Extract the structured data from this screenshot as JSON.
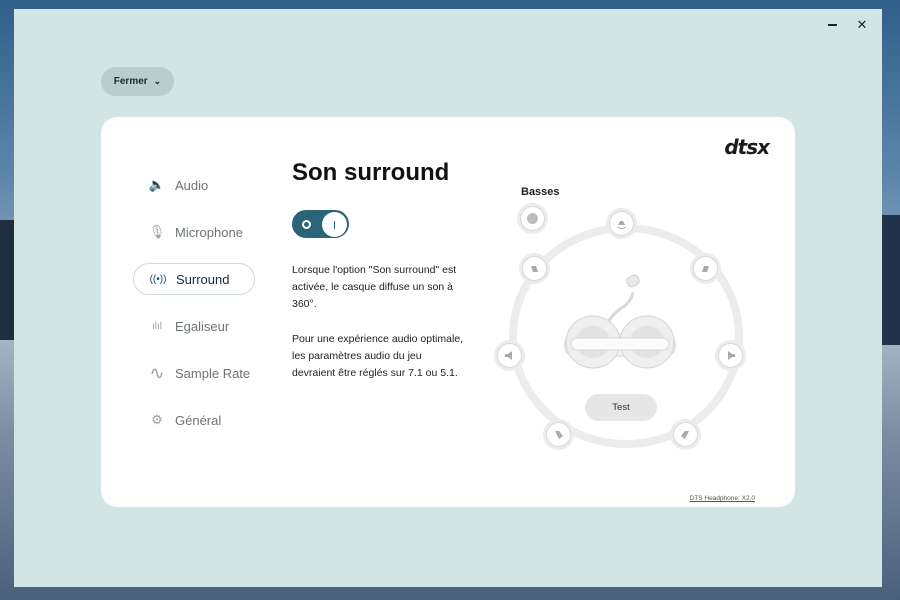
{
  "window": {
    "minimize_icon": "minimize-icon",
    "close_icon": "close-icon",
    "close_glyph": "✕"
  },
  "header": {
    "close_button": "Fermer",
    "chevron_glyph": "⌄"
  },
  "brand": {
    "logo": "dtsx"
  },
  "nav": {
    "items": [
      {
        "label": "Audio",
        "icon": "speaker-icon",
        "glyph": "🔈",
        "active": false
      },
      {
        "label": "Microphone",
        "icon": "microphone-icon",
        "glyph": "🎙",
        "active": false
      },
      {
        "label": "Surround",
        "icon": "surround-icon",
        "glyph": "((•))",
        "active": true
      },
      {
        "label": "Egaliseur",
        "icon": "equalizer-icon",
        "glyph": "ılıl",
        "active": false
      },
      {
        "label": "Sample Rate",
        "icon": "wave-icon",
        "glyph": "∿",
        "active": false
      },
      {
        "label": "Général",
        "icon": "gear-icon",
        "glyph": "⚙",
        "active": false
      }
    ]
  },
  "main": {
    "title": "Son surround",
    "toggle_on": true,
    "description_1": "Lorsque l'option \"Son surround\" est activée, le casque diffuse un son à 360°.",
    "description_2": "Pour une expérience audio optimale, les paramètres audio du jeu devraient être réglés sur 7.1 ou 5.1."
  },
  "speakers": {
    "bass_label": "Basses",
    "test_button": "Test"
  },
  "footer": {
    "version": "DTS Headphone: X2.0"
  },
  "colors": {
    "accent": "#2b6477",
    "background": "#d3e4e4",
    "card": "#ffffff"
  }
}
